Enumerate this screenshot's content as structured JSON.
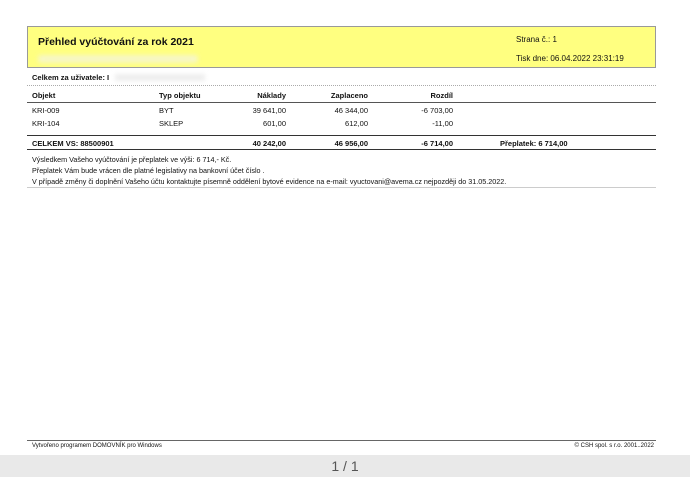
{
  "header": {
    "title": "Přehled vyúčtování za rok  2021",
    "page_no": "Strana č.: 1",
    "print_date": "Tisk dne: 06.04.2022 23:31:19"
  },
  "user_total_label": "Celkem za uživatele: I",
  "table": {
    "columns": [
      "Objekt",
      "Typ objektu",
      "Náklady",
      "Zaplaceno",
      "Rozdíl"
    ],
    "rows": [
      [
        "KRI-009",
        "BYT",
        "39 641,00",
        "46 344,00",
        "-6 703,00"
      ],
      [
        "KRI-104",
        "SKLEP",
        "601,00",
        "612,00",
        "-11,00"
      ]
    ],
    "total": {
      "label": "CELKEM VS: 88500901",
      "naklady": "40 242,00",
      "zaplaceno": "46 956,00",
      "rozdil": "-6 714,00",
      "preplatek": "Přeplatek:   6 714,00"
    }
  },
  "notes": [
    "Výsledkem Vašeho vyúčtování je přeplatek ve výši:  6 714,- Kč.",
    "Přeplatek Vám bude vrácen dle platné legislativy na bankovní účet číslo .",
    "V případě změny či doplnění Vašeho účtu kontaktujte písemně oddělení bytové evidence na e-mail: vyuctovani@avema.cz nejpozději do 31.05.2022."
  ],
  "footer": {
    "left": "Vytvořeno programem DOMOVNÍK pro Windows",
    "right": "© CSH spol. s r.o. 2001..2022"
  },
  "pager": "1 / 1"
}
